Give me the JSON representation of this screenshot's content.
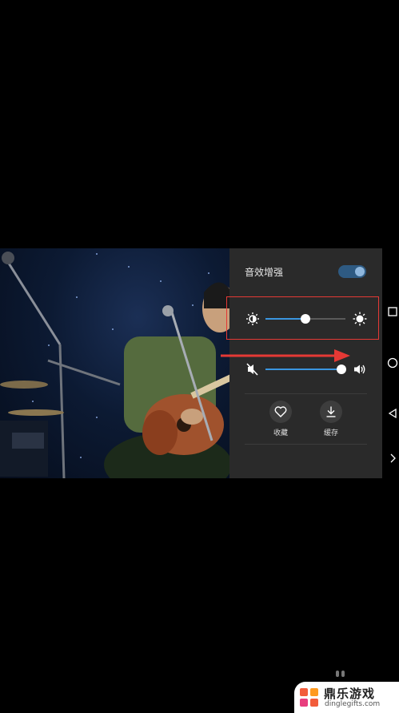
{
  "panel": {
    "sound_enhance_label": "音效增强",
    "sound_enhance_on": true,
    "brightness_level": 0.5,
    "volume_level": 0.95,
    "favorite_label": "收藏",
    "cache_label": "缓存"
  },
  "colors": {
    "accent": "#3a96e0",
    "highlight_box": "#e53935",
    "panel_bg": "#2a2a2a"
  },
  "icons": {
    "brightness_low": "brightness-low-icon",
    "brightness_high": "brightness-high-icon",
    "mute": "mute-icon",
    "volume": "volume-icon",
    "favorite": "heart-icon",
    "cache": "download-icon"
  },
  "watermark": {
    "title": "鼎乐游戏",
    "url": "dinglegifts.com"
  }
}
